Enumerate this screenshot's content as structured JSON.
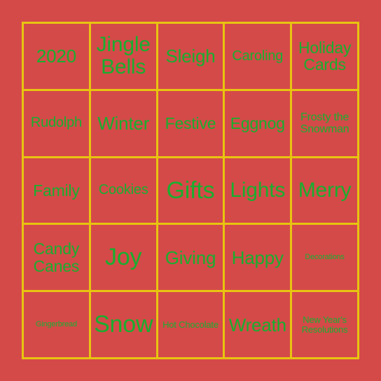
{
  "card": {
    "type": "bingo-card",
    "grid_rows": 5,
    "grid_columns": 5,
    "colors": {
      "background": "#d44a49",
      "grid_line": "#e8c410",
      "text": "#19af2e"
    },
    "cells": [
      {
        "label": "2020",
        "size": "lg",
        "lines": 1
      },
      {
        "label": "Jingle Bells",
        "size": "xl",
        "lines": 2
      },
      {
        "label": "Sleigh",
        "size": "lg",
        "lines": 1
      },
      {
        "label": "Caroling",
        "size": "sm",
        "lines": 1
      },
      {
        "label": "Holiday Cards",
        "size": "md",
        "lines": 2
      },
      {
        "label": "Rudolph",
        "size": "sm",
        "lines": 1
      },
      {
        "label": "Winter",
        "size": "lg",
        "lines": 1
      },
      {
        "label": "Festive",
        "size": "md",
        "lines": 1
      },
      {
        "label": "Eggnog",
        "size": "md",
        "lines": 1
      },
      {
        "label": "Frosty the Snowman",
        "size": "xs",
        "lines": 2
      },
      {
        "label": "Family",
        "size": "md",
        "lines": 1
      },
      {
        "label": "Cookies",
        "size": "sm",
        "lines": 1
      },
      {
        "label": "Gifts",
        "size": "xxl",
        "lines": 1
      },
      {
        "label": "Lights",
        "size": "xl",
        "lines": 1
      },
      {
        "label": "Merry",
        "size": "xl",
        "lines": 1
      },
      {
        "label": "Candy Canes",
        "size": "md",
        "lines": 2
      },
      {
        "label": "Joy",
        "size": "xxl",
        "lines": 1
      },
      {
        "label": "Giving",
        "size": "lg",
        "lines": 1
      },
      {
        "label": "Happy",
        "size": "lg",
        "lines": 1
      },
      {
        "label": "Decorations",
        "size": "tiny",
        "lines": 1
      },
      {
        "label": "Gingerbread",
        "size": "tiny",
        "lines": 1
      },
      {
        "label": "Snow",
        "size": "xxl",
        "lines": 1
      },
      {
        "label": "Hot Chocolate",
        "size": "xxs",
        "lines": 2
      },
      {
        "label": "Wreath",
        "size": "lg",
        "lines": 1
      },
      {
        "label": "New Year's Resolutions",
        "size": "xxs",
        "lines": 2
      }
    ]
  }
}
